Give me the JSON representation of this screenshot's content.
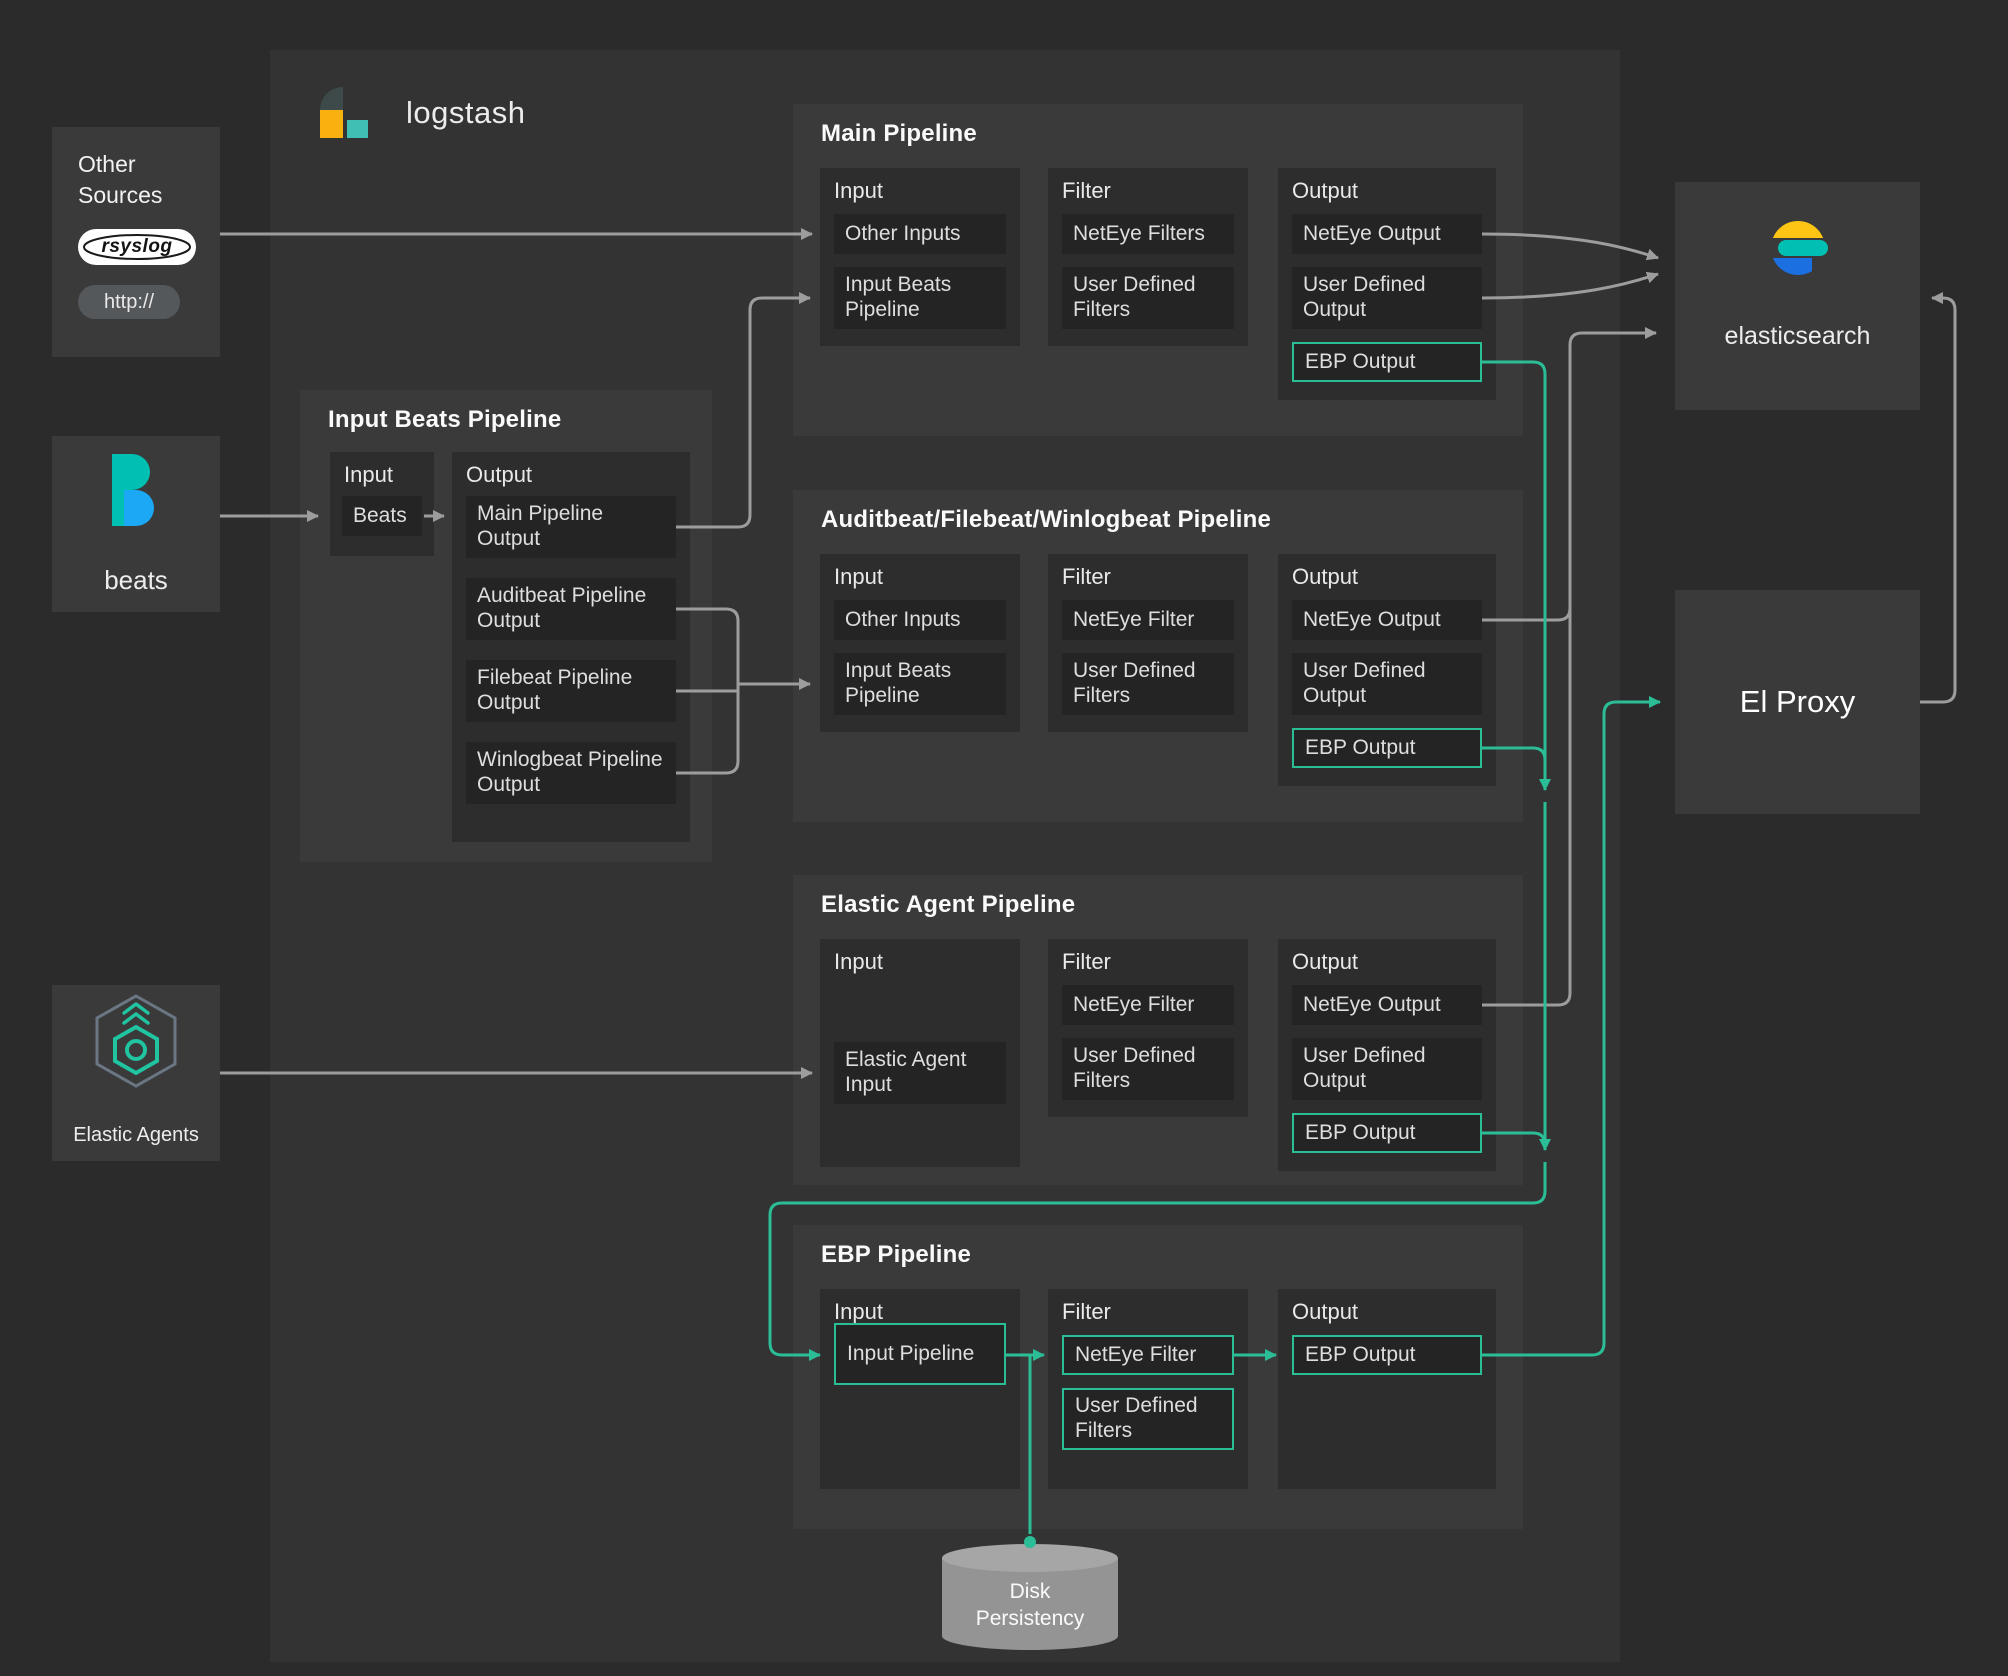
{
  "colors": {
    "background": "#2b2b2b",
    "logstash_panel": "#333333",
    "card": "#3a3a3a",
    "column": "#2d2d2d",
    "item": "#242424",
    "accent_teal": "#2abd96",
    "wire_gray": "#9d9d9d",
    "logo_yellow": "#f9b110",
    "logo_teal": "#40bfb4",
    "elastic_yellow": "#fec514",
    "elastic_teal": "#00bfb3",
    "elastic_blue": "#1b6fe0",
    "beats_teal": "#00bfb3",
    "beats_blue": "#1ba9f5"
  },
  "header": {
    "logo_icon": "logstash-logo",
    "logo_text": "logstash"
  },
  "left": {
    "other_sources": {
      "title": "Other Sources",
      "rsyslog_label": "rsyslog",
      "http_label": "http://"
    },
    "beats": {
      "icon": "beats-logo",
      "label": "beats"
    },
    "elastic_agents": {
      "icon": "elastic-agent-hexagon",
      "label": "Elastic Agents"
    }
  },
  "right": {
    "elasticsearch": {
      "icon": "elastic-logo",
      "label": "elasticsearch"
    },
    "el_proxy": {
      "label": "El Proxy"
    }
  },
  "input_beats_pipeline": {
    "title": "Input Beats Pipeline",
    "input_title": "Input",
    "output_title": "Output",
    "input_items": [
      "Beats"
    ],
    "output_items": [
      "Main Pipeline Output",
      "Auditbeat Pipeline Output",
      "Filebeat Pipeline Output",
      "Winlogbeat Pipeline Output"
    ]
  },
  "pipelines": [
    {
      "title": "Main Pipeline",
      "columns": [
        {
          "title": "Input",
          "items": [
            {
              "label": "Other Inputs"
            },
            {
              "label": "Input Beats Pipeline"
            }
          ]
        },
        {
          "title": "Filter",
          "items": [
            {
              "label": "NetEye Filters"
            },
            {
              "label": "User Defined Filters"
            }
          ]
        },
        {
          "title": "Output",
          "items": [
            {
              "label": "NetEye Output"
            },
            {
              "label": "User Defined Output"
            },
            {
              "label": "EBP Output",
              "accent": true
            }
          ]
        }
      ]
    },
    {
      "title": "Auditbeat/Filebeat/Winlogbeat Pipeline",
      "columns": [
        {
          "title": "Input",
          "items": [
            {
              "label": "Other Inputs"
            },
            {
              "label": "Input Beats Pipeline"
            }
          ]
        },
        {
          "title": "Filter",
          "items": [
            {
              "label": "NetEye Filter"
            },
            {
              "label": "User Defined Filters"
            }
          ]
        },
        {
          "title": "Output",
          "items": [
            {
              "label": "NetEye Output"
            },
            {
              "label": "User Defined Output"
            },
            {
              "label": "EBP Output",
              "accent": true
            }
          ]
        }
      ]
    },
    {
      "title": "Elastic Agent  Pipeline",
      "columns": [
        {
          "title": "Input",
          "items": [
            {
              "label": "Elastic Agent Input"
            }
          ]
        },
        {
          "title": "Filter",
          "items": [
            {
              "label": "NetEye Filter"
            },
            {
              "label": "User Defined Filters"
            }
          ]
        },
        {
          "title": "Output",
          "items": [
            {
              "label": "NetEye Output"
            },
            {
              "label": "User Defined Output"
            },
            {
              "label": "EBP Output",
              "accent": true
            }
          ]
        }
      ]
    },
    {
      "title": "EBP Pipeline",
      "columns": [
        {
          "title": "Input",
          "items": [
            {
              "label": "Input Pipeline",
              "accent": true
            }
          ]
        },
        {
          "title": "Filter",
          "items": [
            {
              "label": "NetEye Filter",
              "accent": true
            },
            {
              "label": "User Defined Filters",
              "accent": true
            }
          ]
        },
        {
          "title": "Output",
          "items": [
            {
              "label": "EBP Output",
              "accent": true
            }
          ]
        }
      ]
    }
  ],
  "disk": {
    "label": "Disk Persistency"
  }
}
